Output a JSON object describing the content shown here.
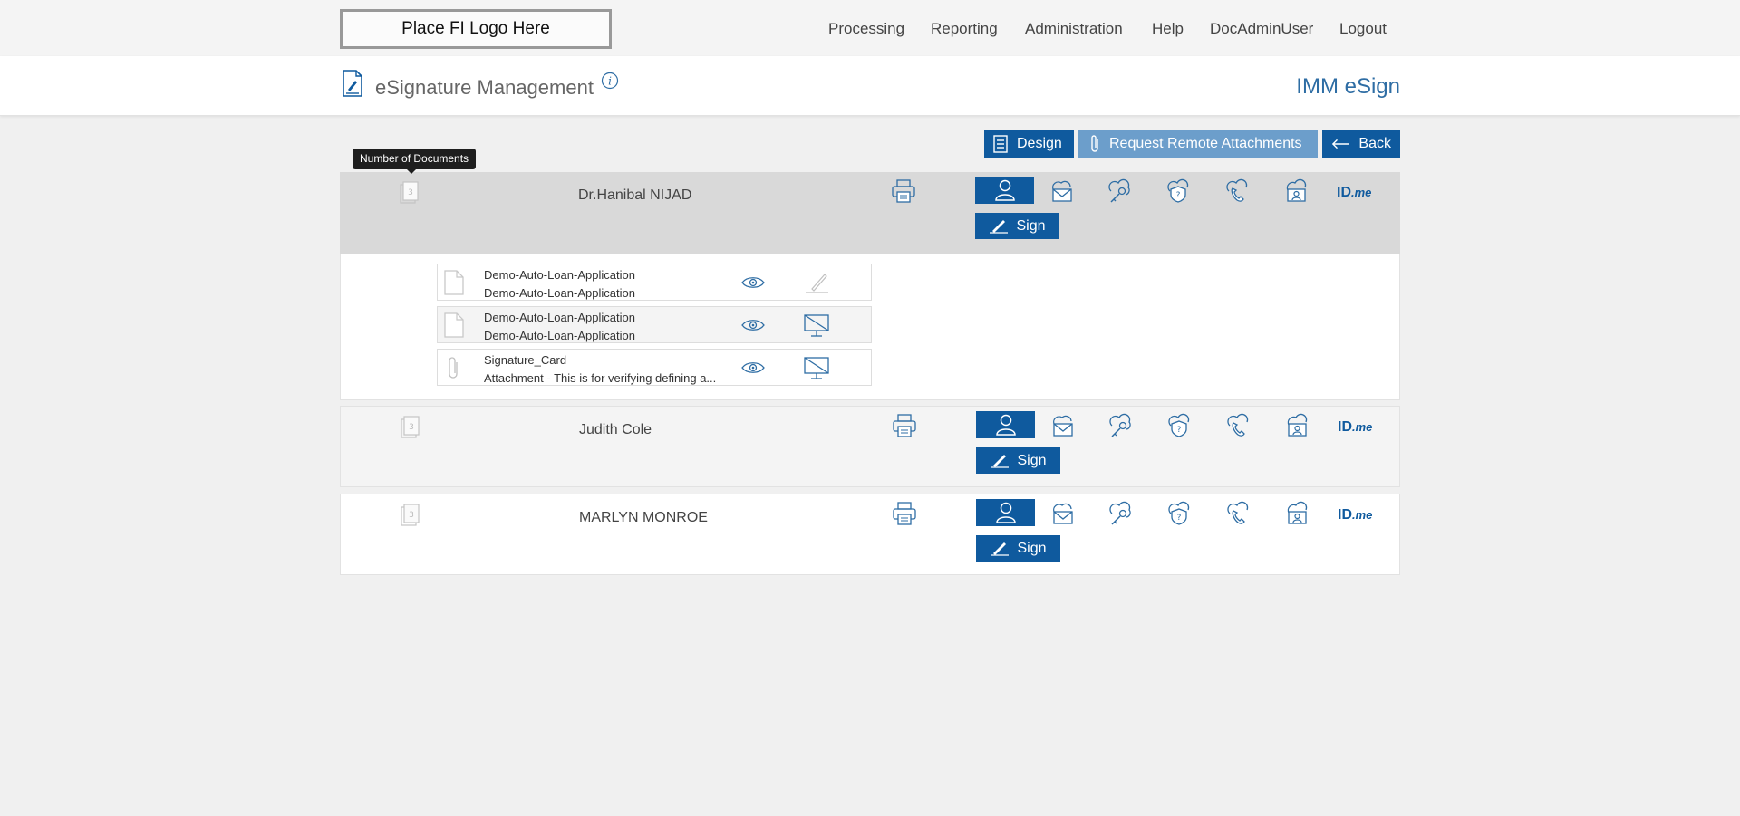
{
  "header": {
    "logo_text": "Place FI Logo Here",
    "nav": [
      "Processing",
      "Reporting",
      "Administration",
      "Help",
      "DocAdminUser",
      "Logout"
    ]
  },
  "titlebar": {
    "title": "eSignature Management",
    "app_name": "IMM eSign",
    "icons": [
      "document-sign-icon",
      "info-icon"
    ]
  },
  "actions": {
    "design": "Design",
    "request_attachments": "Request Remote Attachments",
    "back": "Back"
  },
  "tooltip": "Number of Documents",
  "signers": [
    {
      "name": "Dr.Hanibal NIJAD",
      "doc_count": "3",
      "sign_label": "Sign",
      "idme": "ID",
      "idme_suffix": ".me",
      "expanded": true
    },
    {
      "name": "Judith Cole",
      "doc_count": "3",
      "sign_label": "Sign",
      "idme": "ID",
      "idme_suffix": ".me",
      "expanded": false
    },
    {
      "name": "MARLYN MONROE",
      "doc_count": "3",
      "sign_label": "Sign",
      "idme": "ID",
      "idme_suffix": ".me",
      "expanded": false
    }
  ],
  "signer_auth_icons": [
    "user-icon",
    "email-cloud-icon",
    "key-cloud-icon",
    "question-shield-icon",
    "phone-cloud-icon",
    "id-cloud-icon",
    "idme-logo"
  ],
  "documents": [
    {
      "line1": "Demo-Auto-Loan-Application",
      "line2": "Demo-Auto-Loan-Application",
      "type": "document-icon",
      "action": "signature-pen-icon"
    },
    {
      "line1": "Demo-Auto-Loan-Application",
      "line2": "Demo-Auto-Loan-Application",
      "type": "document-icon",
      "action": "no-display-icon"
    },
    {
      "line1": "Signature_Card",
      "line2": "Attachment - This is for verifying defining a...",
      "type": "paperclip-icon",
      "action": "no-display-icon"
    }
  ],
  "colors": {
    "primary": "#0f5a9e",
    "primary_light": "#6c9ecb",
    "accent_text": "#2e6da4",
    "expanded_row": "#d9d9d9",
    "row": "#f4f4f4"
  }
}
